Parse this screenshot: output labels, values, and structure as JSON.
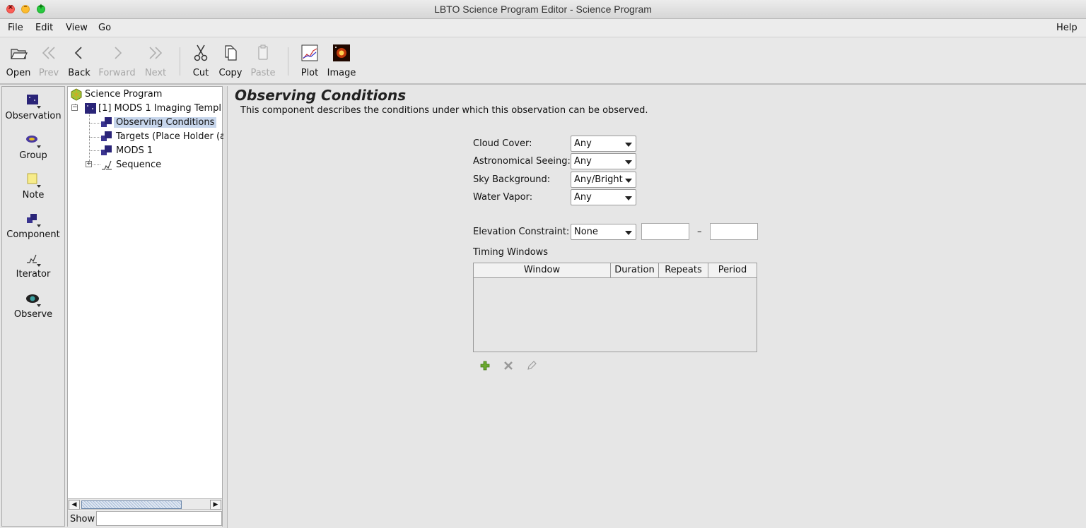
{
  "window": {
    "title": "LBTO Science Program Editor - Science Program"
  },
  "menubar": {
    "file": "File",
    "edit": "Edit",
    "view": "View",
    "go": "Go",
    "help": "Help"
  },
  "toolbar": {
    "open": "Open",
    "prev": "Prev",
    "back": "Back",
    "forward": "Forward",
    "next": "Next",
    "cut": "Cut",
    "copy": "Copy",
    "paste": "Paste",
    "plot": "Plot",
    "image": "Image"
  },
  "palette": {
    "observation": "Observation",
    "group": "Group",
    "note": "Note",
    "component": "Component",
    "iterator": "Iterator",
    "observe": "Observe"
  },
  "tree": {
    "root": "Science Program",
    "observation": "[1] MODS 1 Imaging Templ",
    "observing_conditions": "Observing Conditions",
    "targets": "Targets (Place Holder (a",
    "mods": "MODS 1",
    "sequence": "Sequence",
    "show_label": "Show",
    "show_value": ""
  },
  "content": {
    "title": "Observing Conditions",
    "description": "This component describes the conditions under which this observation can be observed.",
    "cloud_cover_label": "Cloud Cover:",
    "cloud_cover_value": "Any",
    "seeing_label": "Astronomical Seeing:",
    "seeing_value": "Any",
    "sky_background_label": "Sky Background:",
    "sky_background_value": "Any/Bright",
    "water_vapor_label": "Water Vapor:",
    "water_vapor_value": "Any",
    "elevation_label": "Elevation Constraint:",
    "elevation_value": "None",
    "elevation_min": "",
    "elevation_max": "",
    "elevation_dash": "–",
    "timing_windows_label": "Timing Windows",
    "timing_columns": [
      "Window",
      "Duration",
      "Repeats",
      "Period"
    ]
  },
  "colors": {
    "selection": "#c7d6ec",
    "accent_plus": "#5a9a2a"
  }
}
